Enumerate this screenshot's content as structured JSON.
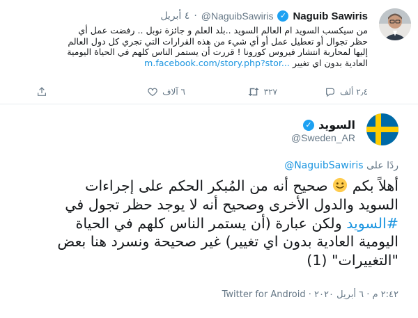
{
  "quoted": {
    "name": "Naguib Sawiris",
    "handle": "@NaguibSawiris",
    "date": "٤ أبريل",
    "text_lines": [
      "من سيكسب السويد ام العالم السويد ..بلد العلم و جائزة نوبل .. رفضت عمل أي",
      "حظر تجوال أو تعطيل عمل أو أي شيء من هذه القرارات التي تجري كل دول العالم",
      "إليها لمحاربة انتشار فيروس كورونا ! قررت أن يستمر الناس كلهم في الحياة اليومية",
      "العادية بدون اي تغيير"
    ],
    "link": "m.facebook.com/story.php?stor...",
    "replies": "٢٫٤ ألف",
    "retweets": "٣٢٧",
    "likes": "٦ آلاف"
  },
  "tweet": {
    "name": "السويد",
    "handle": "@Sweden_AR",
    "reply_prefix": "ردًا على",
    "reply_to": "@NaguibSawiris",
    "line1_a": "أهلاً بكم",
    "line1_b": "صحيح أنه من المُبكر الحكم على إجراءات",
    "line2": "السويد والدول الأخرى وصحيح أنه لا يوجد حظر تجول في",
    "hashtag": "#السويد",
    "line3_rest": "ولكن عبارة (أن يستمر الناس كلهم في الحياة",
    "line4": "اليومية العادية بدون اي تغيير) غير صحيحة ونسرد هنا بعض",
    "line5": "\"التغييرات\" (1)",
    "timestamp": "٢:٤٢ م · ٦ أبريل ٢٠٢٠ ·",
    "source": "Twitter for Android"
  },
  "colors": {
    "link": "#1b95e0",
    "muted": "#657786",
    "text": "#14171a",
    "verified": "#1da1f2",
    "flag_blue": "#006aa7",
    "flag_yellow": "#fecc00"
  },
  "icons": [
    "verified-badge-icon",
    "reply-icon",
    "retweet-icon",
    "like-icon",
    "share-icon",
    "smiley-emoji"
  ]
}
